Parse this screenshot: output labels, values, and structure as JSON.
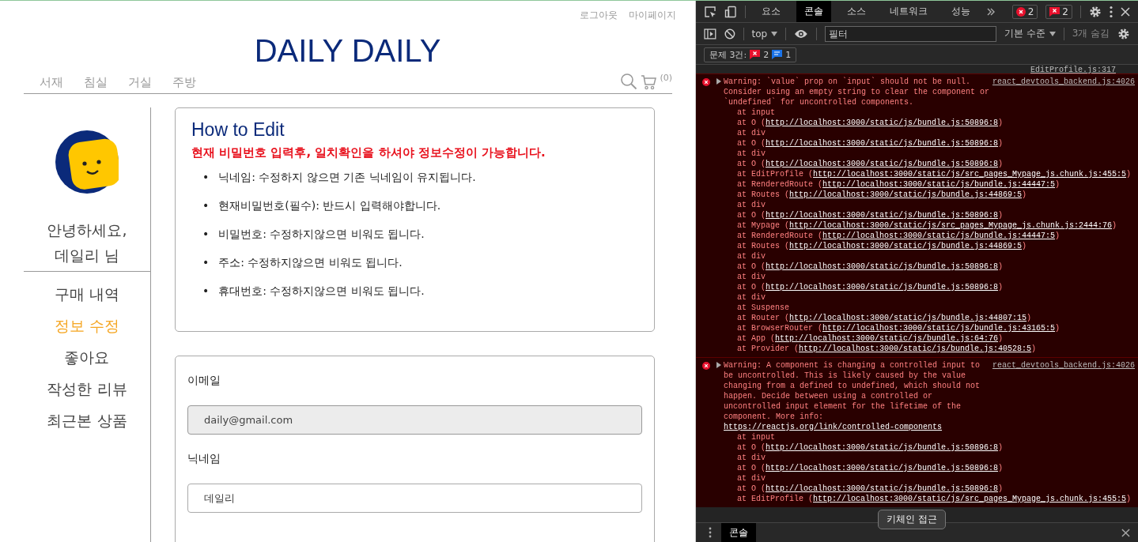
{
  "header": {
    "top_links": [
      "로그아웃",
      "마이페이지"
    ],
    "logo": "DAILY DAILY",
    "nav": [
      "서재",
      "침실",
      "거실",
      "주방"
    ],
    "cart_count": "(0)"
  },
  "sidebar": {
    "greeting_lines": [
      "안녕하세요,",
      "데일리 님"
    ],
    "menu": [
      {
        "label": "구매 내역",
        "selected": false
      },
      {
        "label": "정보 수정",
        "selected": true
      },
      {
        "label": "좋아요",
        "selected": false
      },
      {
        "label": "작성한 리뷰",
        "selected": false
      },
      {
        "label": "최근본 상품",
        "selected": false
      }
    ]
  },
  "guide": {
    "title": "How to Edit",
    "notice": "현재 비밀번호 입력후, 일치확인을 하셔야 정보수정이 가능합니다.",
    "items": [
      {
        "bullet": "•",
        "text": "닉네임: 수정하지 않으면 기존 닉네임이 유지됩니다."
      },
      {
        "bullet": "•",
        "text": "현재비밀번호(필수): 반드시 입력해야합니다."
      },
      {
        "bullet": "•",
        "text": "비밀번호: 수정하지않으면 비워도 됩니다."
      },
      {
        "bullet": "•",
        "text": "주소: 수정하지않으면 비워도 됩니다."
      },
      {
        "bullet": "•",
        "text": "휴대번호: 수정하지않으면 비워도 됩니다."
      }
    ]
  },
  "form": {
    "fields": [
      {
        "label": "이메일",
        "value": "daily@gmail.com",
        "disabled": true
      },
      {
        "label": "닉네임",
        "value": "데일리",
        "disabled": false
      }
    ]
  },
  "devtools": {
    "tabs": [
      {
        "label": "요소",
        "selected": false
      },
      {
        "label": "콘솔",
        "selected": true
      },
      {
        "label": "소스",
        "selected": false
      },
      {
        "label": "네트워크",
        "selected": false
      },
      {
        "label": "성능",
        "selected": false
      }
    ],
    "error_count": "2",
    "issue_count": "2",
    "context": "top",
    "filter_placeholder": "필터",
    "level": "기본 수준",
    "hidden": "3개 숨김",
    "issues": {
      "label": "문제 3건:",
      "errors": "2",
      "info": "1"
    },
    "cut_source": "EditProfile.js:317",
    "messages": [
      {
        "source": "react_devtools_backend.js:4026",
        "text": "Warning: `value` prop on `input` should not be null. Consider using an empty string to clear the component or `undefined` for uncontrolled components.",
        "frames": [
          {
            "prefix": "at input"
          },
          {
            "prefix": "at O (",
            "url": "http://localhost:3000/static/js/bundle.js:50896:8",
            "suffix": ")"
          },
          {
            "prefix": "at div"
          },
          {
            "prefix": "at O (",
            "url": "http://localhost:3000/static/js/bundle.js:50896:8",
            "suffix": ")"
          },
          {
            "prefix": "at div"
          },
          {
            "prefix": "at O (",
            "url": "http://localhost:3000/static/js/bundle.js:50896:8",
            "suffix": ")"
          },
          {
            "prefix": "at EditProfile (",
            "url": "http://localhost:3000/static/js/src_pages_Mypage_js.chunk.js:455:5",
            "suffix": ")"
          },
          {
            "prefix": "at RenderedRoute (",
            "url": "http://localhost:3000/static/js/bundle.js:44447:5",
            "suffix": ")"
          },
          {
            "prefix": "at Routes (",
            "url": "http://localhost:3000/static/js/bundle.js:44869:5",
            "suffix": ")"
          },
          {
            "prefix": "at div"
          },
          {
            "prefix": "at O (",
            "url": "http://localhost:3000/static/js/bundle.js:50896:8",
            "suffix": ")"
          },
          {
            "prefix": "at Mypage (",
            "url": "http://localhost:3000/static/js/src_pages_Mypage_js.chunk.js:2444:76",
            "suffix": ")"
          },
          {
            "prefix": "at RenderedRoute (",
            "url": "http://localhost:3000/static/js/bundle.js:44447:5",
            "suffix": ")"
          },
          {
            "prefix": "at Routes (",
            "url": "http://localhost:3000/static/js/bundle.js:44869:5",
            "suffix": ")"
          },
          {
            "prefix": "at div"
          },
          {
            "prefix": "at O (",
            "url": "http://localhost:3000/static/js/bundle.js:50896:8",
            "suffix": ")"
          },
          {
            "prefix": "at div"
          },
          {
            "prefix": "at O (",
            "url": "http://localhost:3000/static/js/bundle.js:50896:8",
            "suffix": ")"
          },
          {
            "prefix": "at div"
          },
          {
            "prefix": "at Suspense"
          },
          {
            "prefix": "at Router (",
            "url": "http://localhost:3000/static/js/bundle.js:44807:15",
            "suffix": ")"
          },
          {
            "prefix": "at BrowserRouter (",
            "url": "http://localhost:3000/static/js/bundle.js:43165:5",
            "suffix": ")"
          },
          {
            "prefix": "at App (",
            "url": "http://localhost:3000/static/js/bundle.js:64:76",
            "suffix": ")"
          },
          {
            "prefix": "at Provider (",
            "url": "http://localhost:3000/static/js/bundle.js:40528:5",
            "suffix": ")"
          }
        ]
      },
      {
        "source": "react_devtools_backend.js:4026",
        "text": "Warning: A component is changing a controlled input to be uncontrolled. This is likely caused by the value changing from a defined to undefined, which should not happen. Decide between using a controlled or uncontrolled input element for the lifetime of the component. More info:",
        "link": "https://reactjs.org/link/controlled-components",
        "frames": [
          {
            "prefix": "at input"
          },
          {
            "prefix": "at O (",
            "url": "http://localhost:3000/static/js/bundle.js:50896:8",
            "suffix": ")"
          },
          {
            "prefix": "at div"
          },
          {
            "prefix": "at O (",
            "url": "http://localhost:3000/static/js/bundle.js:50896:8",
            "suffix": ")"
          },
          {
            "prefix": "at div"
          },
          {
            "prefix": "at O (",
            "url": "http://localhost:3000/static/js/bundle.js:50896:8",
            "suffix": ")"
          },
          {
            "prefix": "at EditProfile (",
            "url": "http://localhost:3000/static/js/src_pages_Mypage_js.chunk.js:455:5",
            "suffix": ")"
          }
        ]
      }
    ],
    "drawer_tab": "콘솔",
    "tooltip": "키체인 접근"
  }
}
